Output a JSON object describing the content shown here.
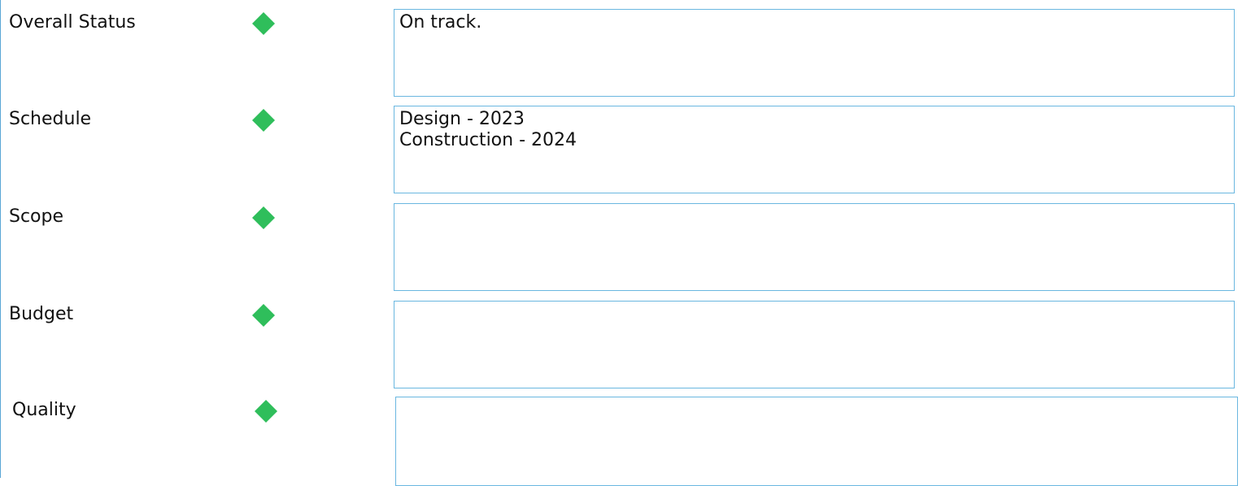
{
  "colors": {
    "status_green": "#2fbe5b",
    "box_border": "#6ab7e0"
  },
  "rows": [
    {
      "label": "Overall Status",
      "status_icon": "green-diamond-icon",
      "text": "On track."
    },
    {
      "label": "Schedule",
      "status_icon": "green-diamond-icon",
      "text": "Design - 2023\nConstruction - 2024"
    },
    {
      "label": "Scope",
      "status_icon": "green-diamond-icon",
      "text": ""
    },
    {
      "label": "Budget",
      "status_icon": "green-diamond-icon",
      "text": ""
    },
    {
      "label": "Quality",
      "status_icon": "green-diamond-icon",
      "text": ""
    }
  ]
}
